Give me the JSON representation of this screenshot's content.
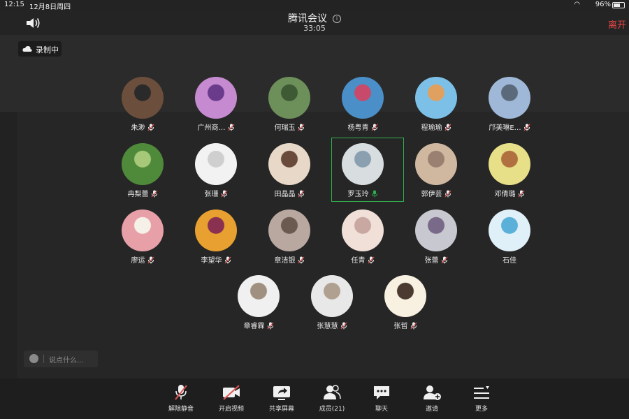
{
  "status_bar": {
    "time": "12:15",
    "date": "12月8日周四",
    "battery": "96%"
  },
  "header": {
    "title": "腾讯会议",
    "timer": "33:05",
    "leave_label": "离开"
  },
  "recording": {
    "label": "录制中"
  },
  "participants": [
    {
      "name": "朱渺",
      "mic": "muted",
      "avatar": [
        "#6b4f3c",
        "#2a2a2a"
      ]
    },
    {
      "name": "广州商…",
      "mic": "muted",
      "avatar": [
        "#c68ad0",
        "#6a3b8a"
      ]
    },
    {
      "name": "何瑞玉",
      "mic": "muted",
      "avatar": [
        "#6d8f5a",
        "#3d5a35"
      ]
    },
    {
      "name": "杨粤青",
      "mic": "muted",
      "avatar": [
        "#4a8fc8",
        "#c84a6a"
      ]
    },
    {
      "name": "程瑜瑜",
      "mic": "muted",
      "avatar": [
        "#7cc0e8",
        "#e0a060"
      ]
    },
    {
      "name": "邝美琳E…",
      "mic": "muted",
      "avatar": [
        "#9fb8d8",
        "#5a6a7a"
      ]
    },
    {
      "name": "冉梨蕾",
      "mic": "muted",
      "avatar": [
        "#4f8a3a",
        "#a6c878"
      ]
    },
    {
      "name": "张珊",
      "mic": "muted",
      "avatar": [
        "#f2f2f2",
        "#cfcfcf"
      ]
    },
    {
      "name": "田晶晶",
      "mic": "muted",
      "avatar": [
        "#e8d8c8",
        "#6a4a3a"
      ]
    },
    {
      "name": "罗玉玲",
      "mic": "active",
      "avatar": [
        "#d8dde0",
        "#8aa0b0"
      ]
    },
    {
      "name": "郭伊芸",
      "mic": "muted",
      "avatar": [
        "#d0b8a0",
        "#9a8070"
      ]
    },
    {
      "name": "邓倩璐",
      "mic": "muted",
      "avatar": [
        "#e8e088",
        "#b07040"
      ]
    },
    {
      "name": "廖运",
      "mic": "muted",
      "avatar": [
        "#e8a0a8",
        "#f5f0e8"
      ]
    },
    {
      "name": "李望华",
      "mic": "muted",
      "avatar": [
        "#e8a030",
        "#8a3050"
      ]
    },
    {
      "name": "章洁银",
      "mic": "muted",
      "avatar": [
        "#b8a8a0",
        "#6a5a50"
      ]
    },
    {
      "name": "任青",
      "mic": "muted",
      "avatar": [
        "#f0e0d8",
        "#c8a8a0"
      ]
    },
    {
      "name": "张蕾",
      "mic": "muted",
      "avatar": [
        "#c8c8d0",
        "#7a6a8a"
      ]
    },
    {
      "name": "石佳",
      "mic": "none",
      "avatar": [
        "#e0f0f8",
        "#5ab0d8"
      ]
    },
    {
      "name": "章睿霖",
      "mic": "muted",
      "avatar": [
        "#f0f0f0",
        "#a09080"
      ]
    },
    {
      "name": "张慧慧",
      "mic": "muted",
      "avatar": [
        "#e8e8e8",
        "#b0a090"
      ]
    },
    {
      "name": "张哲",
      "mic": "muted",
      "avatar": [
        "#f8f0e0",
        "#4a3a30"
      ]
    }
  ],
  "chat": {
    "placeholder": "说点什么..."
  },
  "toolbar": {
    "unmute": "解除静音",
    "start_video": "开启视频",
    "share_screen": "共享屏幕",
    "members": "成员(21)",
    "chat": "聊天",
    "invite": "邀请",
    "more": "更多"
  },
  "colors": {
    "leave": "#e64545",
    "active_speaker": "#2fae4e",
    "muted_icon": "#e05555"
  }
}
